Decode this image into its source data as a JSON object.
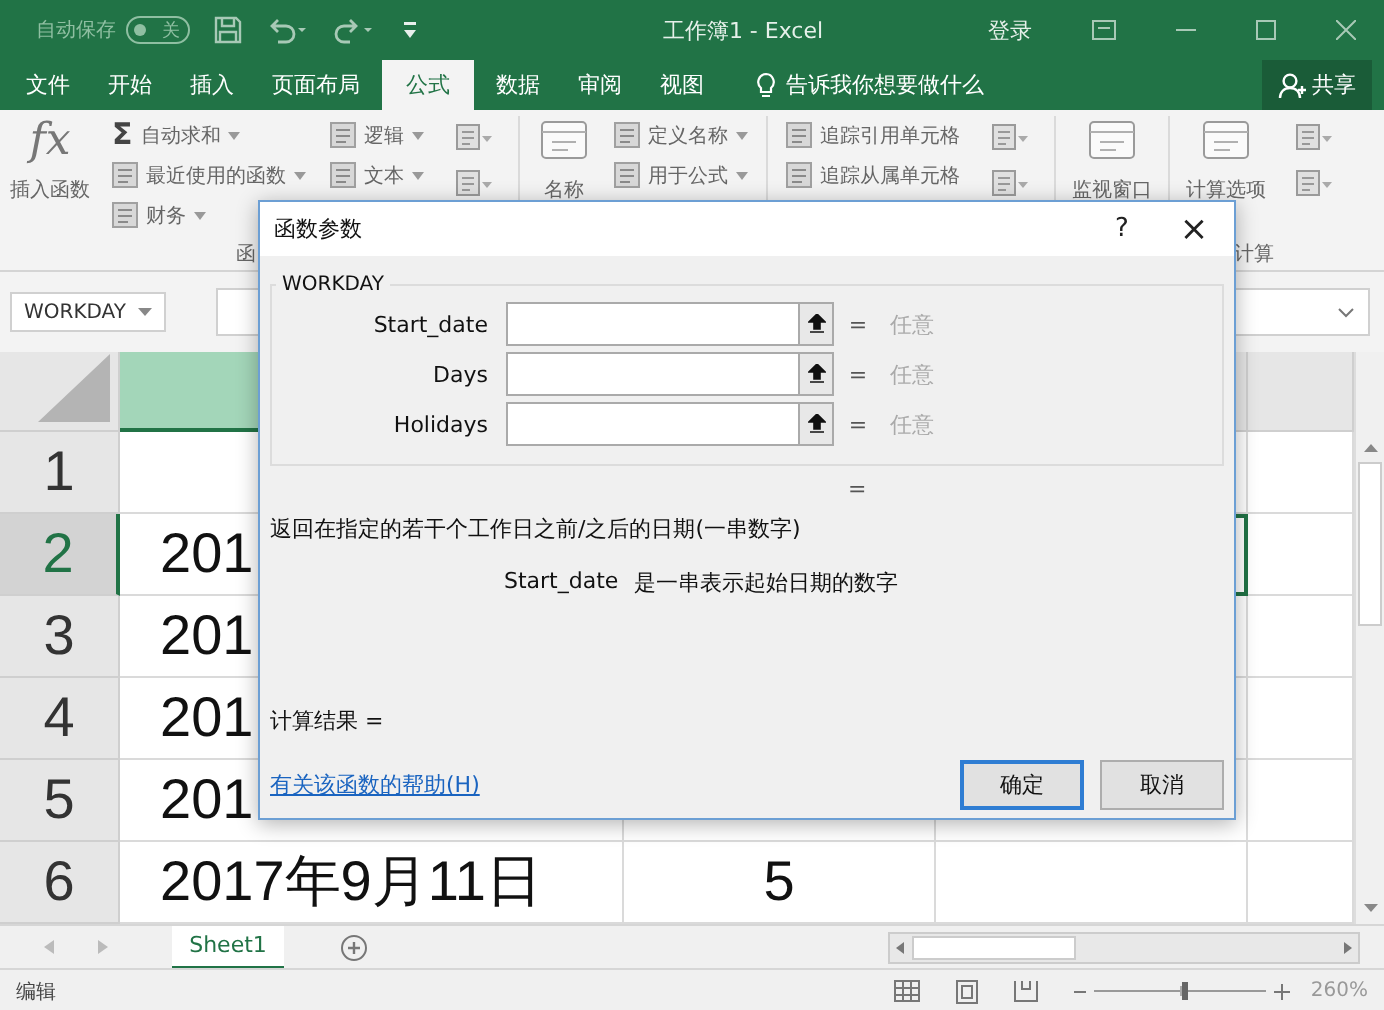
{
  "title_bar": {
    "autosave": {
      "label": "自动保存",
      "on": false,
      "toggle_text": "关"
    },
    "title": "工作簿1 - Excel",
    "sign_in": "登录"
  },
  "ribbon_tabs": [
    {
      "label": "文件",
      "selected": false
    },
    {
      "label": "开始",
      "selected": false
    },
    {
      "label": "插入",
      "selected": false
    },
    {
      "label": "页面布局",
      "selected": false
    },
    {
      "label": "公式",
      "selected": true
    },
    {
      "label": "数据",
      "selected": false
    },
    {
      "label": "审阅",
      "selected": false
    },
    {
      "label": "视图",
      "selected": false
    }
  ],
  "tell_me": "告诉我你想要做什么",
  "share": "共享",
  "ribbon": {
    "columns": [
      {
        "kind": "large",
        "glyph": "fx",
        "label": "插入函数"
      },
      {
        "kind": "stack",
        "items": [
          {
            "glyph": "Σ",
            "label": "自动求和",
            "dropdown": true
          },
          {
            "label": "最近使用的函数",
            "dropdown": true
          },
          {
            "label": "财务",
            "dropdown": true
          }
        ]
      },
      {
        "kind": "stack",
        "items": [
          {
            "label": "逻辑",
            "dropdown": true
          },
          {
            "label": "文本",
            "dropdown": true
          }
        ]
      },
      {
        "kind": "icons"
      },
      {
        "kind": "large",
        "label": "名称"
      },
      {
        "kind": "stack",
        "items": [
          {
            "label": "定义名称",
            "dropdown": true
          },
          {
            "label": "用于公式",
            "dropdown": true
          }
        ]
      },
      {
        "kind": "stack",
        "items": [
          {
            "label": "追踪引用单元格",
            "dropdown": false
          },
          {
            "label": "追踪从属单元格",
            "dropdown": false
          }
        ]
      },
      {
        "kind": "icons"
      },
      {
        "kind": "large",
        "label": "监视窗口"
      },
      {
        "kind": "large",
        "label": "计算选项"
      },
      {
        "kind": "icons"
      }
    ],
    "group_labels": [
      "函",
      "计算"
    ]
  },
  "name_box": "WORKDAY",
  "rows": [
    {
      "header": "1",
      "selected": false
    },
    {
      "header": "2",
      "selected": true,
      "cells": [
        "201"
      ]
    },
    {
      "header": "3",
      "selected": false,
      "cells": [
        "201"
      ]
    },
    {
      "header": "4",
      "selected": false,
      "cells": [
        "201"
      ]
    },
    {
      "header": "5",
      "selected": false,
      "cells": [
        "201"
      ]
    },
    {
      "header": "6",
      "selected": false,
      "cells": [
        "2017年9月11日",
        "5"
      ]
    }
  ],
  "sheet_tabs": [
    {
      "label": "Sheet1",
      "selected": true
    }
  ],
  "status_bar": {
    "mode": "编辑",
    "zoom": {
      "level": 0.52,
      "reading": "260%"
    }
  },
  "dialog": {
    "title": "函数参数",
    "help": "?",
    "close": "×",
    "function_name": "WORKDAY",
    "args": [
      {
        "label": "Start_date",
        "equals": "=",
        "result": "任意"
      },
      {
        "label": "Days",
        "equals": "=",
        "result": "任意"
      },
      {
        "label": "Holidays",
        "equals": "=",
        "result": "任意"
      }
    ],
    "result_equals": "=",
    "description": "返回在指定的若干个工作日之前/之后的日期(一串数字)",
    "arg_name": "Start_date",
    "arg_description": "是一串表示起始日期的数字",
    "formula_result": "计算结果 =",
    "help_link": "有关该函数的帮助(H)",
    "buttons": [
      {
        "label": "确定",
        "default": true
      },
      {
        "label": "取消",
        "default": false
      }
    ]
  }
}
